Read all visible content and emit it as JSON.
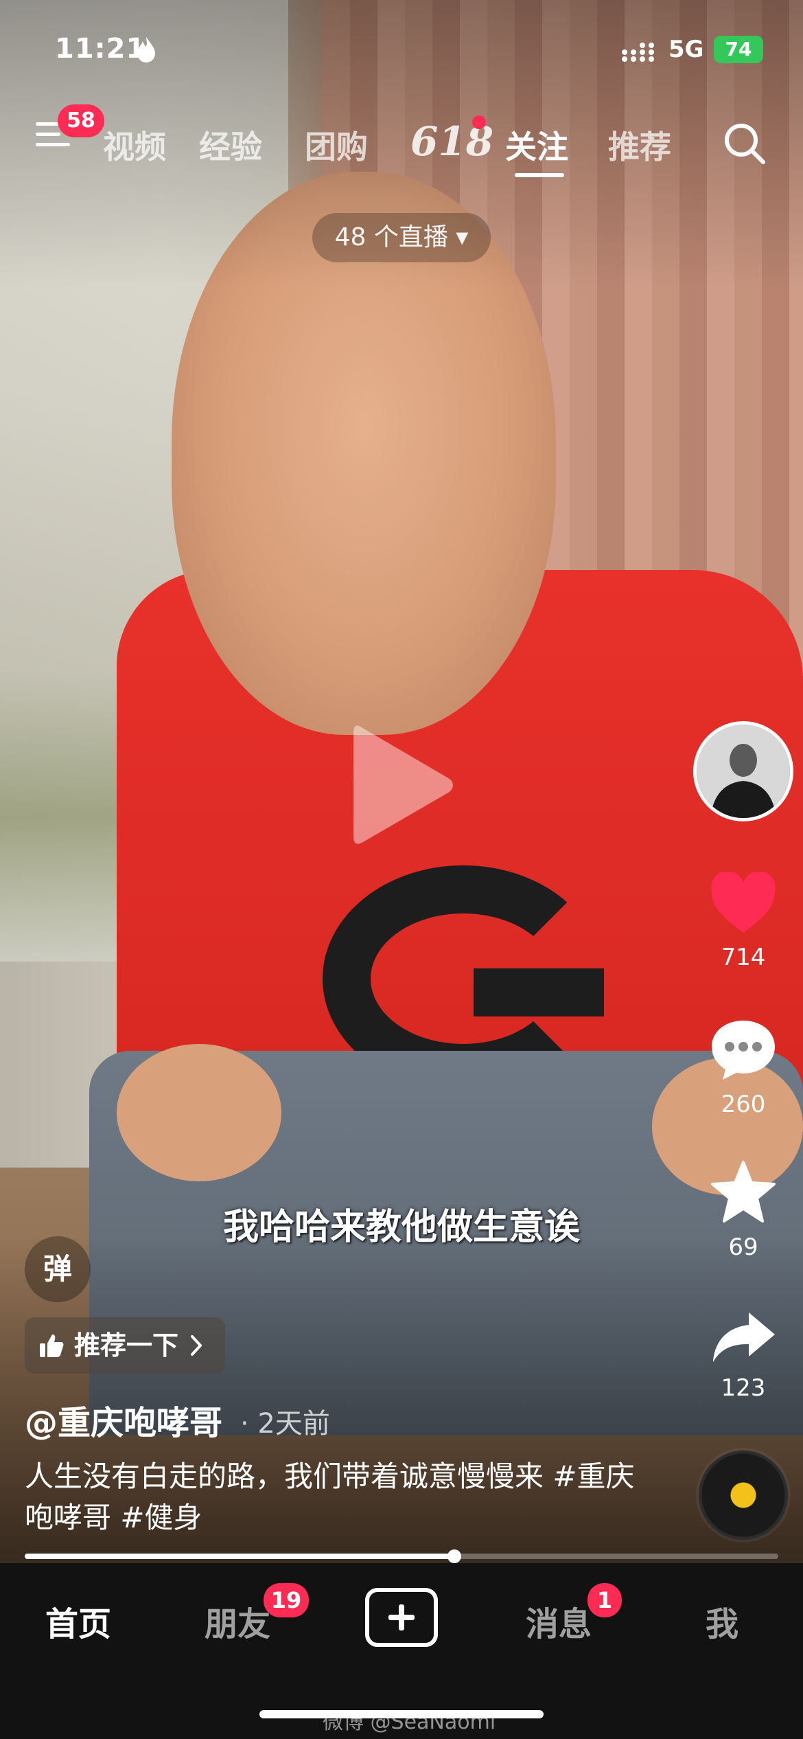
{
  "status_bar": {
    "time": "11:21",
    "network": "5G",
    "battery": "74"
  },
  "top_nav": {
    "menu_badge": "58",
    "tabs": [
      "视频",
      "经验",
      "团购",
      "618",
      "关注",
      "推荐"
    ],
    "active_tab": "关注"
  },
  "live": {
    "label": "48 个直播 ▾"
  },
  "subtitle": "我哈哈来教他做生意诶",
  "side_actions": {
    "likes": "714",
    "comments": "260",
    "favorites": "69",
    "shares": "123"
  },
  "danmaku_label": "弹",
  "recommend": {
    "label": "推荐一下"
  },
  "post": {
    "author": "@重庆咆哮哥",
    "time": "· 2天前",
    "description": "人生没有白走的路，我们带着诚意慢慢来 #重庆咆哮哥 #健身"
  },
  "progress": {
    "fraction": 0.57
  },
  "bottom_nav": {
    "home": "首页",
    "friends": "朋友",
    "friends_badge": "19",
    "messages": "消息",
    "messages_badge": "1",
    "me": "我"
  },
  "watermark": "微博 @SeaNaomi",
  "colors": {
    "accent": "#fe2c55",
    "battery": "#34c759",
    "music_disc": "#f2c21a"
  }
}
